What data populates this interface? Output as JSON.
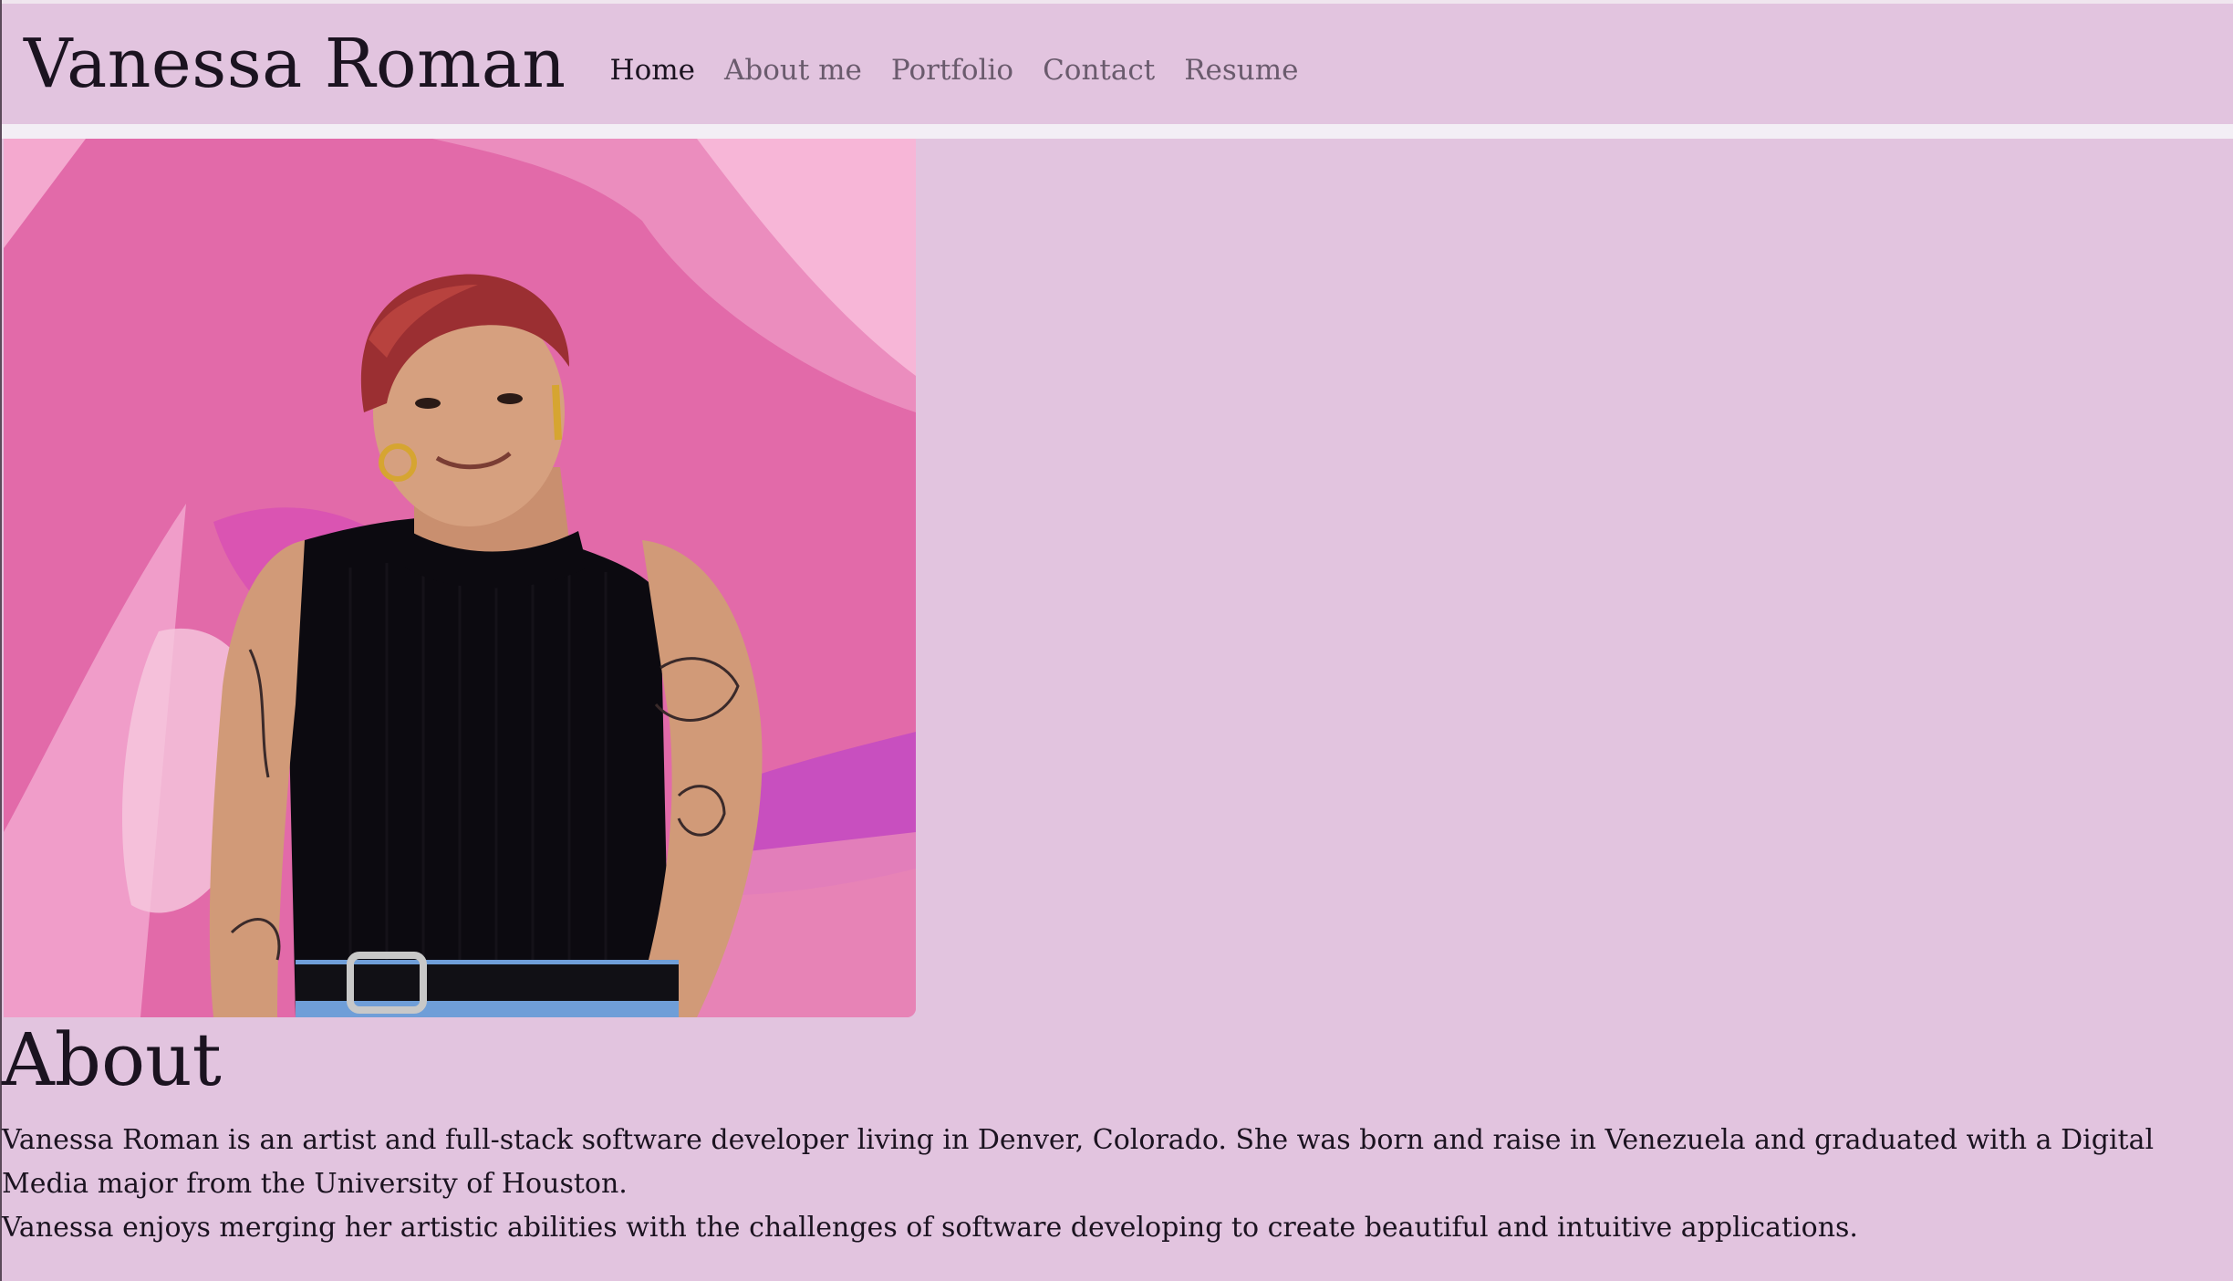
{
  "brand": "Vanessa Roman",
  "nav": {
    "home": "Home",
    "about": "About me",
    "portfolio": "Portfolio",
    "contact": "Contact",
    "resume": "Resume"
  },
  "hero_image": {
    "alt": "Portrait of Vanessa Roman in front of a pink mural"
  },
  "about": {
    "heading": "About",
    "paragraph_1": "Vanessa Roman is an artist and full-stack software developer living in Denver, Colorado. She was born and raise in Venezuela and graduated with a Digital Media major from the University of Houston.",
    "paragraph_2": "Vanessa enjoys merging her artistic abilities with the challenges of software developing to create beautiful and intuitive applications."
  },
  "colors": {
    "background": "#e2c4df",
    "separator": "#f3eef5",
    "text": "#1b1320",
    "nav_inactive": "#6a5b6d",
    "mural_pink": "#e86fb0"
  }
}
